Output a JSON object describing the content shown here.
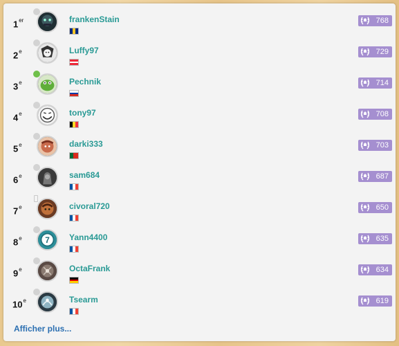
{
  "leaderboard": {
    "entries": [
      {
        "rank": "1",
        "suffix": "er",
        "name": "frankenStain",
        "status": "offline",
        "flag": "barbados",
        "elo": "768"
      },
      {
        "rank": "2",
        "suffix": "e",
        "name": "Luffy97",
        "status": "offline",
        "flag": "austria",
        "elo": "729"
      },
      {
        "rank": "3",
        "suffix": "e",
        "name": "Pechnik",
        "status": "online",
        "flag": "russia",
        "elo": "714"
      },
      {
        "rank": "4",
        "suffix": "e",
        "name": "tony97",
        "status": "offline",
        "flag": "belgium",
        "elo": "708"
      },
      {
        "rank": "5",
        "suffix": "e",
        "name": "darki333",
        "status": "offline",
        "flag": "portugal",
        "elo": "703"
      },
      {
        "rank": "6",
        "suffix": "e",
        "name": "sam684",
        "status": "offline",
        "flag": "france",
        "elo": "687"
      },
      {
        "rank": "7",
        "suffix": "e",
        "name": "civoral720",
        "status": "mobile",
        "flag": "france",
        "elo": "650"
      },
      {
        "rank": "8",
        "suffix": "e",
        "name": "Yann4400",
        "status": "offline",
        "flag": "france",
        "elo": "635"
      },
      {
        "rank": "9",
        "suffix": "e",
        "name": "OctaFrank",
        "status": "offline",
        "flag": "germany",
        "elo": "634"
      },
      {
        "rank": "10",
        "suffix": "e",
        "name": "Tsearm",
        "status": "offline",
        "flag": "france",
        "elo": "619"
      }
    ],
    "show_more_label": "Afficher plus...",
    "colors": {
      "name": "#2a9a95",
      "elo_badge": "#a58fd0",
      "link": "#2b6fb1",
      "online": "#6fc04a",
      "offline": "#d3d3d3"
    },
    "icons": {
      "elo": "laurel-icon",
      "status": "status-dot-icon"
    }
  }
}
